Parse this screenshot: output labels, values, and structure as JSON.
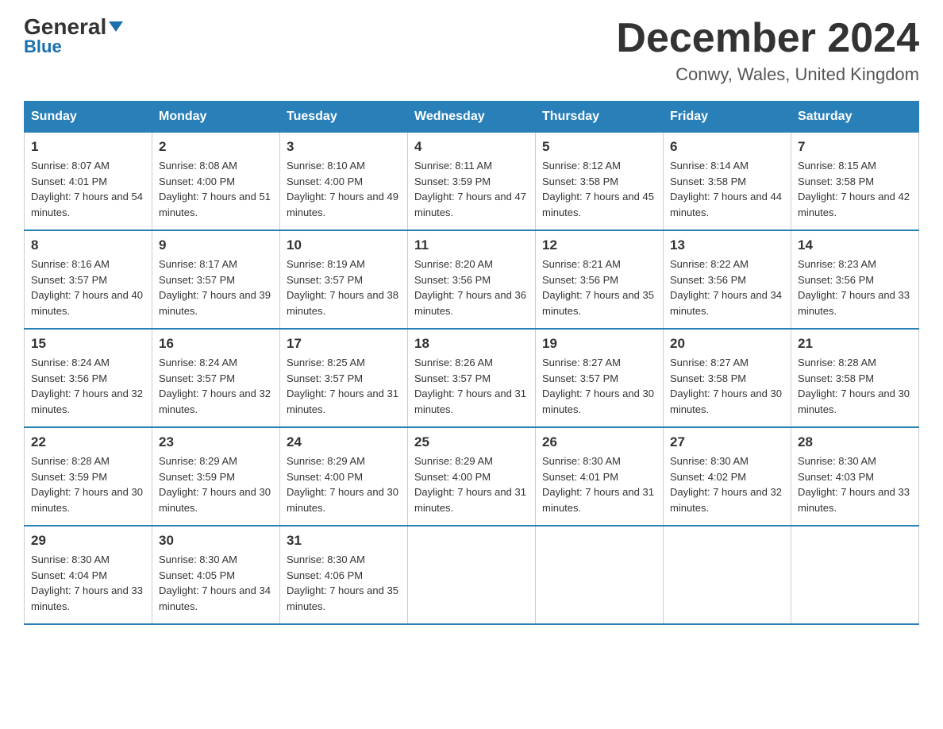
{
  "header": {
    "logo_top": "General",
    "logo_bottom": "Blue",
    "month_title": "December 2024",
    "location": "Conwy, Wales, United Kingdom"
  },
  "days_of_week": [
    "Sunday",
    "Monday",
    "Tuesday",
    "Wednesday",
    "Thursday",
    "Friday",
    "Saturday"
  ],
  "weeks": [
    [
      {
        "num": "1",
        "sunrise": "8:07 AM",
        "sunset": "4:01 PM",
        "daylight": "7 hours and 54 minutes."
      },
      {
        "num": "2",
        "sunrise": "8:08 AM",
        "sunset": "4:00 PM",
        "daylight": "7 hours and 51 minutes."
      },
      {
        "num": "3",
        "sunrise": "8:10 AM",
        "sunset": "4:00 PM",
        "daylight": "7 hours and 49 minutes."
      },
      {
        "num": "4",
        "sunrise": "8:11 AM",
        "sunset": "3:59 PM",
        "daylight": "7 hours and 47 minutes."
      },
      {
        "num": "5",
        "sunrise": "8:12 AM",
        "sunset": "3:58 PM",
        "daylight": "7 hours and 45 minutes."
      },
      {
        "num": "6",
        "sunrise": "8:14 AM",
        "sunset": "3:58 PM",
        "daylight": "7 hours and 44 minutes."
      },
      {
        "num": "7",
        "sunrise": "8:15 AM",
        "sunset": "3:58 PM",
        "daylight": "7 hours and 42 minutes."
      }
    ],
    [
      {
        "num": "8",
        "sunrise": "8:16 AM",
        "sunset": "3:57 PM",
        "daylight": "7 hours and 40 minutes."
      },
      {
        "num": "9",
        "sunrise": "8:17 AM",
        "sunset": "3:57 PM",
        "daylight": "7 hours and 39 minutes."
      },
      {
        "num": "10",
        "sunrise": "8:19 AM",
        "sunset": "3:57 PM",
        "daylight": "7 hours and 38 minutes."
      },
      {
        "num": "11",
        "sunrise": "8:20 AM",
        "sunset": "3:56 PM",
        "daylight": "7 hours and 36 minutes."
      },
      {
        "num": "12",
        "sunrise": "8:21 AM",
        "sunset": "3:56 PM",
        "daylight": "7 hours and 35 minutes."
      },
      {
        "num": "13",
        "sunrise": "8:22 AM",
        "sunset": "3:56 PM",
        "daylight": "7 hours and 34 minutes."
      },
      {
        "num": "14",
        "sunrise": "8:23 AM",
        "sunset": "3:56 PM",
        "daylight": "7 hours and 33 minutes."
      }
    ],
    [
      {
        "num": "15",
        "sunrise": "8:24 AM",
        "sunset": "3:56 PM",
        "daylight": "7 hours and 32 minutes."
      },
      {
        "num": "16",
        "sunrise": "8:24 AM",
        "sunset": "3:57 PM",
        "daylight": "7 hours and 32 minutes."
      },
      {
        "num": "17",
        "sunrise": "8:25 AM",
        "sunset": "3:57 PM",
        "daylight": "7 hours and 31 minutes."
      },
      {
        "num": "18",
        "sunrise": "8:26 AM",
        "sunset": "3:57 PM",
        "daylight": "7 hours and 31 minutes."
      },
      {
        "num": "19",
        "sunrise": "8:27 AM",
        "sunset": "3:57 PM",
        "daylight": "7 hours and 30 minutes."
      },
      {
        "num": "20",
        "sunrise": "8:27 AM",
        "sunset": "3:58 PM",
        "daylight": "7 hours and 30 minutes."
      },
      {
        "num": "21",
        "sunrise": "8:28 AM",
        "sunset": "3:58 PM",
        "daylight": "7 hours and 30 minutes."
      }
    ],
    [
      {
        "num": "22",
        "sunrise": "8:28 AM",
        "sunset": "3:59 PM",
        "daylight": "7 hours and 30 minutes."
      },
      {
        "num": "23",
        "sunrise": "8:29 AM",
        "sunset": "3:59 PM",
        "daylight": "7 hours and 30 minutes."
      },
      {
        "num": "24",
        "sunrise": "8:29 AM",
        "sunset": "4:00 PM",
        "daylight": "7 hours and 30 minutes."
      },
      {
        "num": "25",
        "sunrise": "8:29 AM",
        "sunset": "4:00 PM",
        "daylight": "7 hours and 31 minutes."
      },
      {
        "num": "26",
        "sunrise": "8:30 AM",
        "sunset": "4:01 PM",
        "daylight": "7 hours and 31 minutes."
      },
      {
        "num": "27",
        "sunrise": "8:30 AM",
        "sunset": "4:02 PM",
        "daylight": "7 hours and 32 minutes."
      },
      {
        "num": "28",
        "sunrise": "8:30 AM",
        "sunset": "4:03 PM",
        "daylight": "7 hours and 33 minutes."
      }
    ],
    [
      {
        "num": "29",
        "sunrise": "8:30 AM",
        "sunset": "4:04 PM",
        "daylight": "7 hours and 33 minutes."
      },
      {
        "num": "30",
        "sunrise": "8:30 AM",
        "sunset": "4:05 PM",
        "daylight": "7 hours and 34 minutes."
      },
      {
        "num": "31",
        "sunrise": "8:30 AM",
        "sunset": "4:06 PM",
        "daylight": "7 hours and 35 minutes."
      },
      null,
      null,
      null,
      null
    ]
  ]
}
